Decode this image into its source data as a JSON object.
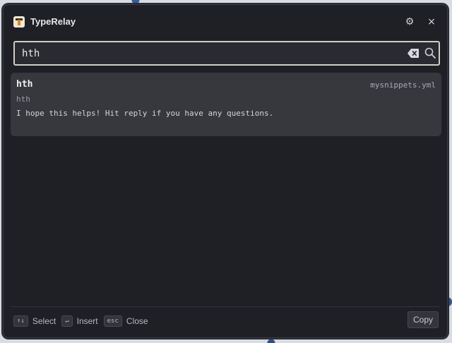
{
  "app": {
    "title": "TypeRelay",
    "logo_icon": "typerelay-logo-icon",
    "settings_icon": "gear-icon",
    "close_glyph": "×",
    "gear_glyph": "⚙"
  },
  "search": {
    "value": "hth",
    "clear_icon": "backspace-clear-icon",
    "search_icon": "search-icon"
  },
  "results": [
    {
      "trigger": "hth",
      "file": "mysnippets.yml",
      "label": "hth",
      "preview": "I hope this helps! Hit reply if you have any questions."
    }
  ],
  "footer": {
    "hints": [
      {
        "key": "↑↓",
        "label": "Select"
      },
      {
        "key": "↵",
        "label": "Insert"
      },
      {
        "key": "esc",
        "label": "Close"
      }
    ],
    "copy_label": "Copy"
  },
  "colors": {
    "window_bg": "#1f1f26",
    "card_bg": "#37373e",
    "search_border": "#d0cfc3",
    "accent_logo": "#d9892e"
  }
}
